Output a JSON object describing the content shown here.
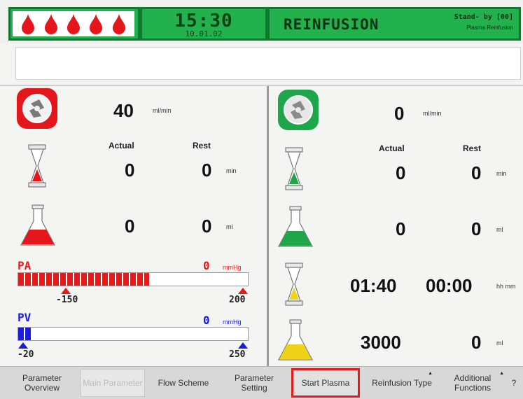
{
  "header": {
    "time": "15:30",
    "date": "10.01.02",
    "mode": "REINFUSION",
    "status_line1": "Stand- by [00]",
    "status_line2": "Plasma Reinfusion"
  },
  "left": {
    "pump_rate": "40",
    "pump_unit": "ml/min",
    "col_actual": "Actual",
    "col_rest": "Rest",
    "time_actual": "0",
    "time_rest": "0",
    "time_unit": "min",
    "vol_actual": "0",
    "vol_rest": "0",
    "vol_unit": "ml",
    "pa_label": "PA",
    "pa_value": "0",
    "pa_unit": "mmHg",
    "pa_min": "-150",
    "pa_max": "200",
    "pa_fill": 0.57,
    "pv_label": "PV",
    "pv_value": "0",
    "pv_unit": "mmHg",
    "pv_min": "-20",
    "pv_max": "250",
    "pv_fill": 0.06
  },
  "right": {
    "pump_rate": "0",
    "pump_unit": "ml/min",
    "col_actual": "Actual",
    "col_rest": "Rest",
    "time_actual": "0",
    "time_rest": "0",
    "time_unit": "min",
    "vol_actual": "0",
    "vol_rest": "0",
    "vol_unit": "ml",
    "treat_actual": "01:40",
    "treat_rest": "00:00",
    "treat_unit": "hh mm",
    "bag_actual": "3000",
    "bag_rest": "0",
    "bag_unit": "ml"
  },
  "menu": {
    "parameter_overview": "Parameter Overview",
    "main_parameter": "Main Parameter",
    "flow_scheme": "Flow Scheme",
    "parameter_setting": "Parameter Setting",
    "start_plasma": "Start Plasma",
    "reinfusion_type": "Reinfusion Type",
    "additional_functions": "Additional Functions",
    "help": "?"
  },
  "colors": {
    "header_green": "#22b14c",
    "blood_red": "#e4161b",
    "pa_red": "#e31b1b",
    "pv_blue": "#1a1ae0",
    "plasma_green": "#1fa64a",
    "yellow": "#f1d21a"
  },
  "icons": [
    "blood-drop-icon",
    "blood-pump-icon",
    "plasma-pump-icon",
    "hourglass-icon",
    "flask-icon"
  ]
}
